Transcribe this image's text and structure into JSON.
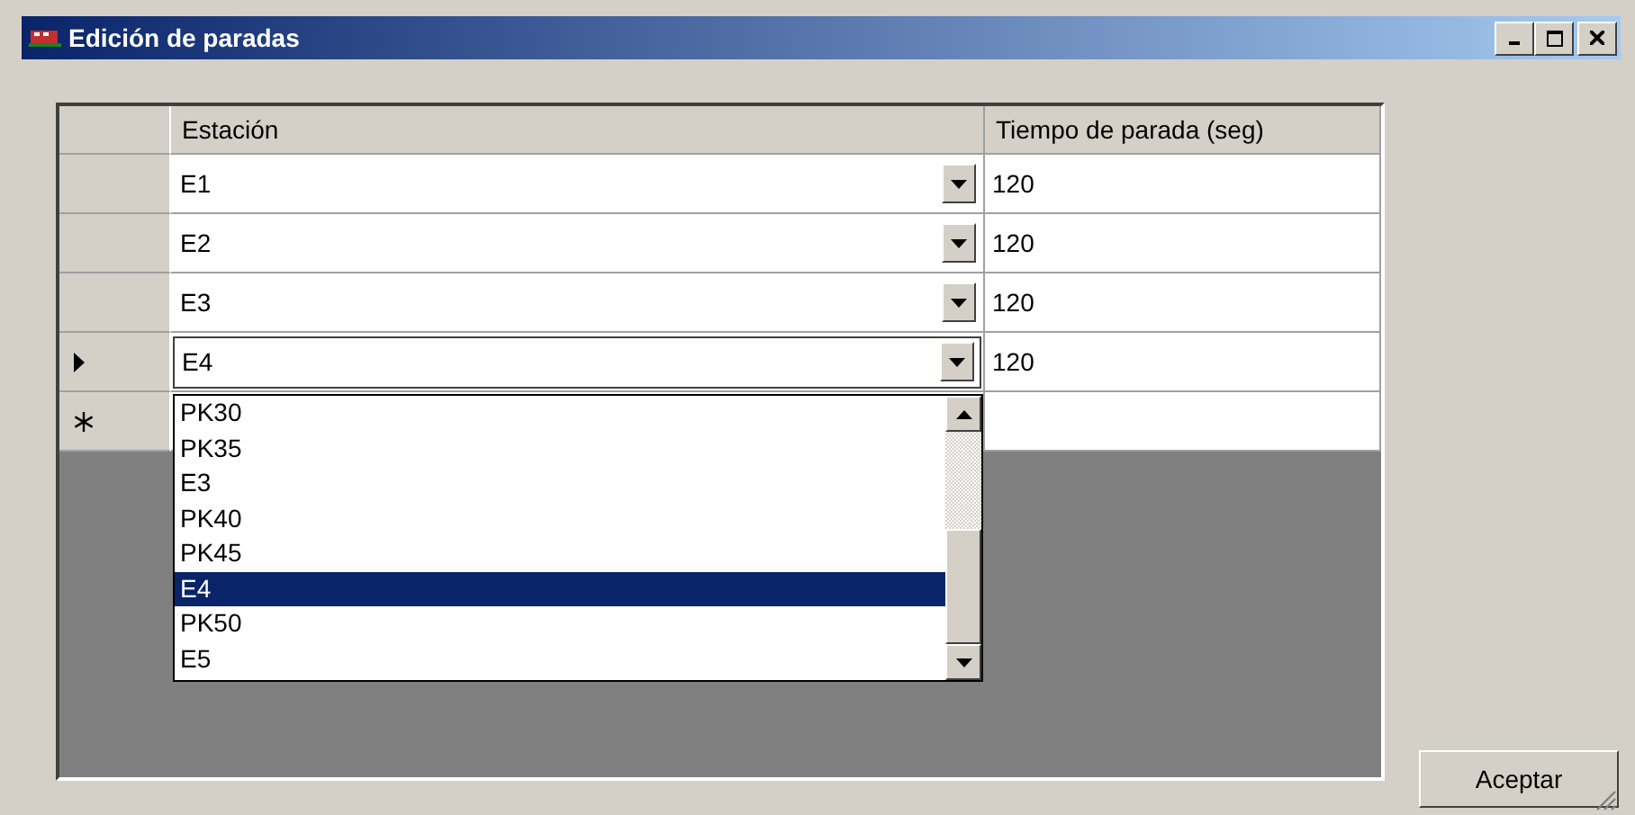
{
  "window": {
    "title": "Edición de paradas"
  },
  "table": {
    "columns": [
      "Estación",
      "Tiempo de parada (seg)"
    ],
    "rows": [
      {
        "station": "E1",
        "time": "120",
        "selected": false
      },
      {
        "station": "E2",
        "time": "120",
        "selected": false
      },
      {
        "station": "E3",
        "time": "120",
        "selected": false
      },
      {
        "station": "E4",
        "time": "120",
        "selected": true
      }
    ],
    "new_row": true
  },
  "dropdown": {
    "items": [
      {
        "label": "PK30",
        "selected": false
      },
      {
        "label": "PK35",
        "selected": false
      },
      {
        "label": "E3",
        "selected": false
      },
      {
        "label": "PK40",
        "selected": false
      },
      {
        "label": "PK45",
        "selected": false
      },
      {
        "label": "E4",
        "selected": true
      },
      {
        "label": "PK50",
        "selected": false
      },
      {
        "label": "E5",
        "selected": false
      }
    ]
  },
  "buttons": [
    "Aceptar"
  ]
}
